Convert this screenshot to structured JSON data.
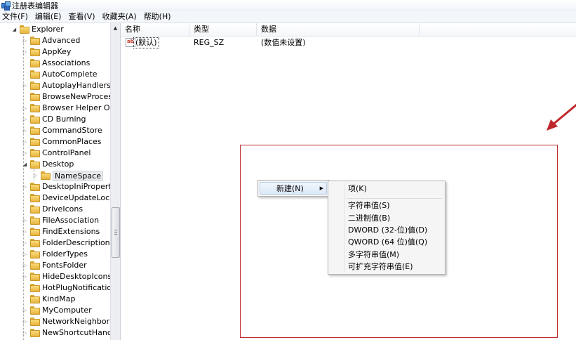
{
  "window": {
    "title": "注册表编辑器"
  },
  "menu": [
    "文件(F)",
    "编辑(E)",
    "查看(V)",
    "收藏夹(A)",
    "帮助(H)"
  ],
  "tree": {
    "root": "Explorer",
    "items": [
      {
        "label": "Advanced"
      },
      {
        "label": "AppKey"
      },
      {
        "label": "Associations"
      },
      {
        "label": "AutoComplete"
      },
      {
        "label": "AutoplayHandlers"
      },
      {
        "label": "BrowseNewProcess"
      },
      {
        "label": "Browser Helper Obje"
      },
      {
        "label": "CD Burning"
      },
      {
        "label": "CommandStore"
      },
      {
        "label": "CommonPlaces"
      },
      {
        "label": "ControlPanel"
      },
      {
        "label": "Desktop"
      },
      {
        "label": "NameSpace"
      },
      {
        "label": "DesktopIniPropertyM"
      },
      {
        "label": "DeviceUpdateLocatio"
      },
      {
        "label": "DriveIcons"
      },
      {
        "label": "FileAssociation"
      },
      {
        "label": "FindExtensions"
      },
      {
        "label": "FolderDescriptions"
      },
      {
        "label": "FolderTypes"
      },
      {
        "label": "FontsFolder"
      },
      {
        "label": "HideDesktopIcons"
      },
      {
        "label": "HotPlugNotification"
      },
      {
        "label": "KindMap"
      },
      {
        "label": "MyComputer"
      },
      {
        "label": "NetworkNeighborho"
      },
      {
        "label": "NewShortcutHandler"
      }
    ]
  },
  "list": {
    "columns": [
      "名称",
      "类型",
      "数据"
    ],
    "rows": [
      {
        "icon": "ab",
        "name": "(默认)",
        "type": "REG_SZ",
        "data": "(数值未设置)"
      }
    ]
  },
  "context_menu": {
    "parent_label": "新建(N)",
    "submenu": [
      "项(K)",
      "字符串值(S)",
      "二进制值(B)",
      "DWORD (32-位)值(D)",
      "QWORD (64 位)值(Q)",
      "多字符串值(M)",
      "可扩充字符串值(E)"
    ]
  },
  "colors": {
    "annotation": "#c0282b",
    "menu_highlight": "#dde9f8",
    "folder": "#e7b43c"
  },
  "icons": [
    "regedit-icon",
    "folder-icon",
    "string-value-icon",
    "expand-arrow-icon",
    "collapse-arrow-icon",
    "submenu-arrow-icon",
    "red-arrow-annotation"
  ]
}
